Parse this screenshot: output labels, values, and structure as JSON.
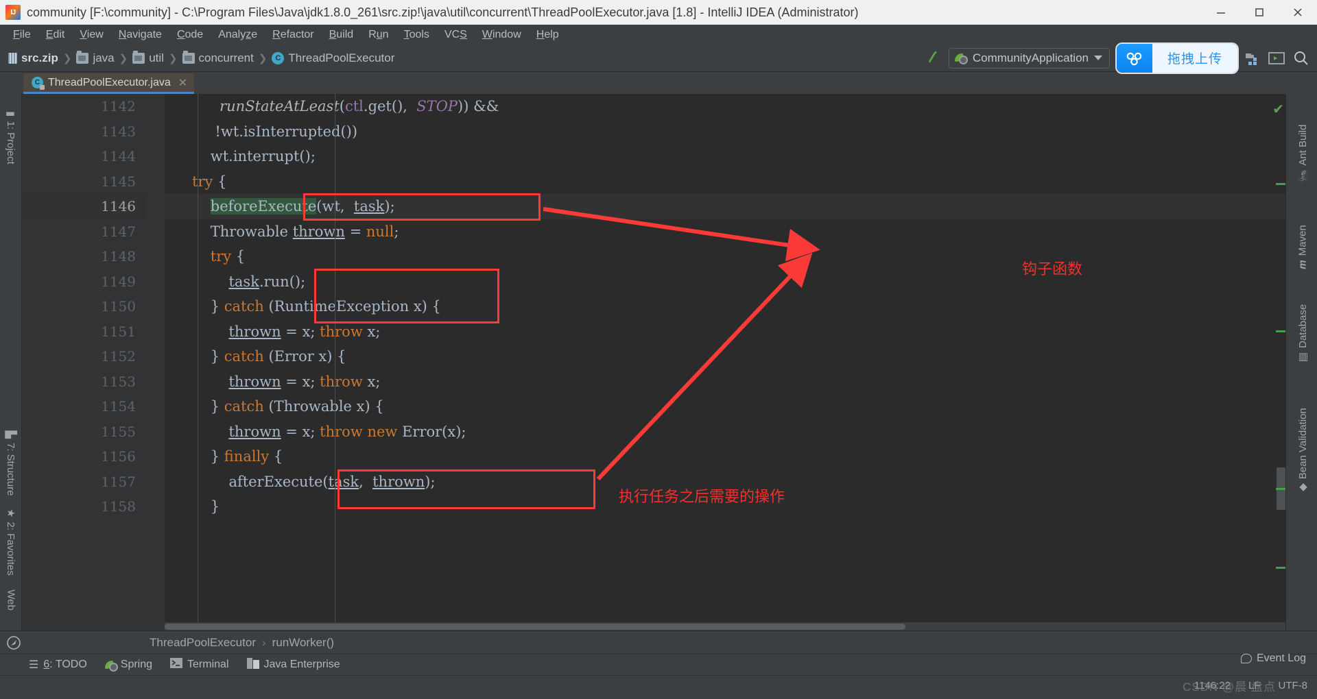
{
  "window": {
    "title": "community [F:\\community] - C:\\Program Files\\Java\\jdk1.8.0_261\\src.zip!\\java\\util\\concurrent\\ThreadPoolExecutor.java [1.8] - IntelliJ IDEA (Administrator)",
    "minimize": "minimize-icon",
    "maximize": "maximize-icon",
    "close": "close-icon"
  },
  "menu": [
    {
      "label": "File",
      "mnemonic": "F"
    },
    {
      "label": "Edit",
      "mnemonic": "E"
    },
    {
      "label": "View",
      "mnemonic": "V"
    },
    {
      "label": "Navigate",
      "mnemonic": "N"
    },
    {
      "label": "Code",
      "mnemonic": "C"
    },
    {
      "label": "Analyze",
      "mnemonic": "z"
    },
    {
      "label": "Refactor",
      "mnemonic": "R"
    },
    {
      "label": "Build",
      "mnemonic": "B"
    },
    {
      "label": "Run",
      "mnemonic": "u"
    },
    {
      "label": "Tools",
      "mnemonic": "T"
    },
    {
      "label": "VCS",
      "mnemonic": "S"
    },
    {
      "label": "Window",
      "mnemonic": "W"
    },
    {
      "label": "Help",
      "mnemonic": "H"
    }
  ],
  "breadcrumb": [
    {
      "label": "src.zip",
      "icon": "zip-icon"
    },
    {
      "label": "java",
      "icon": "folder-icon"
    },
    {
      "label": "util",
      "icon": "folder-icon"
    },
    {
      "label": "concurrent",
      "icon": "folder-icon"
    },
    {
      "label": "ThreadPoolExecutor",
      "icon": "class-icon"
    }
  ],
  "toolbar": {
    "build_icon": "hammer-icon",
    "run_config": "CommunityApplication",
    "run_config_icon": "spring-boot-icon",
    "dropdown_icon": "chevron-down-icon",
    "upload_button_label": "拖拽上传",
    "upload_button_icon": "cloud-upload-icon",
    "upload_button_color": "#1d9bff",
    "project_structure_icon": "project-structure-icon",
    "terminal_icon": "terminal-icon",
    "search_icon": "search-icon"
  },
  "tab": {
    "label": "ThreadPoolExecutor.java",
    "icon": "java-class-readonly-icon",
    "close_icon": "close-icon",
    "accent": "#4a88c7"
  },
  "left_tool_bars": [
    {
      "label": "1: Project",
      "mnemonic": "1",
      "icon": "folder-icon"
    },
    {
      "label": "7: Structure",
      "mnemonic": "7",
      "icon": "structure-icon"
    },
    {
      "label": "2: Favorites",
      "mnemonic": "2",
      "icon": "star-icon"
    },
    {
      "label": "Web",
      "icon": "web-icon"
    }
  ],
  "right_tool_bars": [
    {
      "label": "Ant Build",
      "icon": "ant-icon"
    },
    {
      "label": "Maven",
      "icon": "maven-icon"
    },
    {
      "label": "Database",
      "icon": "database-icon"
    },
    {
      "label": "Bean Validation",
      "icon": "bean-validation-icon"
    }
  ],
  "editor": {
    "first_line": 1142,
    "current_line": 1146,
    "lines": [
      {
        "n": 1142,
        "fold": null,
        "html": "            <i>runStateAtLeast</i>(<f>ctl</f>.get(),  <s>STOP</s>)) &&"
      },
      {
        "n": 1143,
        "fold": null,
        "html": "           !wt.isInterrupted())"
      },
      {
        "n": 1144,
        "fold": null,
        "html": "          wt.interrupt();"
      },
      {
        "n": 1145,
        "fold": "minus",
        "html": "      <k>try</k> {"
      },
      {
        "n": 1146,
        "fold": null,
        "html": "          <h>beforeExecute</h>(wt,  <u>task</u>);"
      },
      {
        "n": 1147,
        "fold": null,
        "html": "          Throwable <u>thrown</u> = <k>null</k>;"
      },
      {
        "n": 1148,
        "fold": "minus",
        "html": "          <k>try</k> {"
      },
      {
        "n": 1149,
        "fold": null,
        "html": "              <u>task</u>.run();"
      },
      {
        "n": 1150,
        "fold": "round",
        "html": "          } <k>catch</k> (RuntimeException x) {"
      },
      {
        "n": 1151,
        "fold": null,
        "html": "              <u>thrown</u> = x; <k>throw</k> x;"
      },
      {
        "n": 1152,
        "fold": "round",
        "html": "          } <k>catch</k> (Error x) {"
      },
      {
        "n": 1153,
        "fold": null,
        "html": "              <u>thrown</u> = x; <k>throw</k> x;"
      },
      {
        "n": 1154,
        "fold": "round",
        "html": "          } <k>catch</k> (Throwable x) {"
      },
      {
        "n": 1155,
        "fold": null,
        "html": "              <u>thrown</u> = x; <k>throw</k> <k>new</k> Error(x);"
      },
      {
        "n": 1156,
        "fold": "round",
        "html": "          } <k>finally</k> {"
      },
      {
        "n": 1157,
        "fold": null,
        "html": "              afterExecute(<u>task</u>,  <u>thrown</u>);"
      },
      {
        "n": 1158,
        "fold": "round",
        "html": "          }"
      }
    ]
  },
  "annotations": {
    "box_color": "#fc3a37",
    "text_color": "#f0312e",
    "label_hook": "钩子函数",
    "label_after": "执行任务之后需要的操作"
  },
  "footer_breadcrumb": {
    "icon": "navigate-icon",
    "items": [
      "ThreadPoolExecutor",
      "runWorker()"
    ],
    "separator": "›"
  },
  "tool_windows": [
    {
      "label": "6: TODO",
      "mnemonic": "6",
      "icon": "todo-icon"
    },
    {
      "label": "Spring",
      "icon": "spring-icon"
    },
    {
      "label": "Terminal",
      "icon": "terminal-icon"
    },
    {
      "label": "Java Enterprise",
      "icon": "java-enterprise-icon"
    }
  ],
  "status": {
    "event_log": "Event Log",
    "event_log_icon": "event-log-icon",
    "caret_position": "1146:22",
    "line_separator": "LF",
    "encoding": "UTF-8",
    "watermark": "CSDN @晨 盘点"
  }
}
